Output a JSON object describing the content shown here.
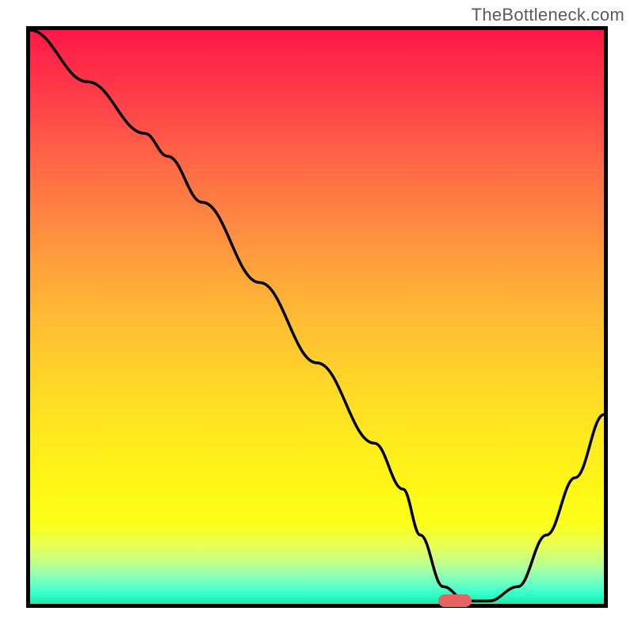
{
  "watermark": "TheBottleneck.com",
  "chart_data": {
    "type": "line",
    "title": "",
    "xlabel": "",
    "ylabel": "",
    "x_range": [
      0,
      100
    ],
    "y_range": [
      0,
      100
    ],
    "grid": false,
    "legend": false,
    "series": [
      {
        "name": "curve",
        "x": [
          0,
          10,
          20,
          24,
          30,
          40,
          50,
          60,
          65,
          68,
          72,
          76,
          80,
          85,
          90,
          95,
          100
        ],
        "y": [
          100,
          91,
          82,
          78,
          70,
          56,
          42,
          28,
          20,
          12,
          3,
          0.5,
          0.5,
          3,
          12,
          22,
          33
        ]
      }
    ],
    "marker": {
      "x": 74,
      "y": 0.5,
      "color": "#e46363"
    },
    "background": "red-yellow-green vertical gradient"
  }
}
